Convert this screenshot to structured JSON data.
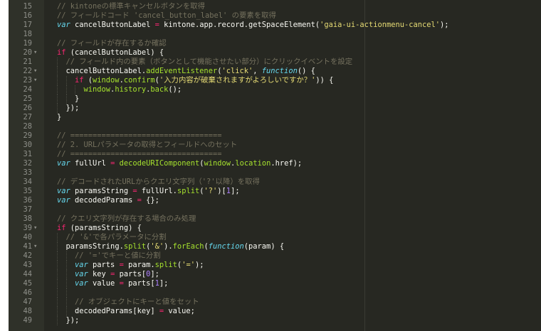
{
  "editor": {
    "lines": [
      {
        "n": "15",
        "fold": "",
        "indent": 1,
        "tokens": [
          [
            "cm",
            "// kintoneの標準キャンセルボタンを取得"
          ]
        ]
      },
      {
        "n": "16",
        "fold": "",
        "indent": 1,
        "tokens": [
          [
            "cm",
            "// フィールドコード 'cancel_button_label' の要素を取得"
          ]
        ]
      },
      {
        "n": "17",
        "fold": "",
        "indent": 1,
        "tokens": [
          [
            "kw",
            "var"
          ],
          [
            "pl",
            " cancelButtonLabel "
          ],
          [
            "op",
            "="
          ],
          [
            "pl",
            " kintone.app.record.getSpaceElement("
          ],
          [
            "str",
            "'gaia-ui-actionmenu-cancel'"
          ],
          [
            "pl",
            ");"
          ]
        ]
      },
      {
        "n": "18",
        "fold": "",
        "indent": 1,
        "tokens": []
      },
      {
        "n": "19",
        "fold": "",
        "indent": 1,
        "tokens": [
          [
            "cm",
            "// フィールドが存在するか確認"
          ]
        ]
      },
      {
        "n": "20",
        "fold": "▾",
        "indent": 1,
        "tokens": [
          [
            "ctl",
            "if"
          ],
          [
            "pl",
            " (cancelButtonLabel) {"
          ]
        ]
      },
      {
        "n": "21",
        "fold": "",
        "indent": 2,
        "tokens": [
          [
            "cm",
            "// フィールド内の要素（ボタンとして機能させたい部分）にクリックイベントを設定"
          ]
        ]
      },
      {
        "n": "22",
        "fold": "▾",
        "indent": 2,
        "tokens": [
          [
            "pl",
            "cancelButtonLabel."
          ],
          [
            "fn",
            "addEventListener"
          ],
          [
            "pl",
            "("
          ],
          [
            "str",
            "'click'"
          ],
          [
            "pl",
            ", "
          ],
          [
            "kw",
            "function"
          ],
          [
            "pl",
            "() {"
          ]
        ]
      },
      {
        "n": "23",
        "fold": "▾",
        "indent": 3,
        "tokens": [
          [
            "ctl",
            "if"
          ],
          [
            "pl",
            " ("
          ],
          [
            "fn",
            "window"
          ],
          [
            "pl",
            "."
          ],
          [
            "fn",
            "confirm"
          ],
          [
            "pl",
            "("
          ],
          [
            "str",
            "'入力内容が破棄されますがよろしいですか？'"
          ],
          [
            "pl",
            ")) {"
          ]
        ]
      },
      {
        "n": "24",
        "fold": "",
        "indent": 4,
        "tokens": [
          [
            "fn",
            "window"
          ],
          [
            "pl",
            "."
          ],
          [
            "fn",
            "history"
          ],
          [
            "pl",
            "."
          ],
          [
            "fn",
            "back"
          ],
          [
            "pl",
            "();"
          ]
        ]
      },
      {
        "n": "25",
        "fold": "",
        "indent": 3,
        "tokens": [
          [
            "pl",
            "}"
          ]
        ]
      },
      {
        "n": "26",
        "fold": "",
        "indent": 2,
        "tokens": [
          [
            "pl",
            "});"
          ]
        ]
      },
      {
        "n": "27",
        "fold": "",
        "indent": 1,
        "tokens": [
          [
            "pl",
            "}"
          ]
        ]
      },
      {
        "n": "28",
        "fold": "",
        "indent": 1,
        "tokens": []
      },
      {
        "n": "29",
        "fold": "",
        "indent": 1,
        "tokens": [
          [
            "cm",
            "// =================================="
          ]
        ]
      },
      {
        "n": "30",
        "fold": "",
        "indent": 1,
        "tokens": [
          [
            "cm",
            "// 2. URLパラメータの取得とフィールドへのセット"
          ]
        ]
      },
      {
        "n": "31",
        "fold": "",
        "indent": 1,
        "tokens": [
          [
            "cm",
            "// =================================="
          ]
        ]
      },
      {
        "n": "32",
        "fold": "",
        "indent": 1,
        "tokens": [
          [
            "kw",
            "var"
          ],
          [
            "pl",
            " fullUrl "
          ],
          [
            "op",
            "="
          ],
          [
            "pl",
            " "
          ],
          [
            "fn",
            "decodeURIComponent"
          ],
          [
            "pl",
            "("
          ],
          [
            "fn",
            "window"
          ],
          [
            "pl",
            "."
          ],
          [
            "fn",
            "location"
          ],
          [
            "pl",
            ".href);"
          ]
        ]
      },
      {
        "n": "33",
        "fold": "",
        "indent": 1,
        "tokens": []
      },
      {
        "n": "34",
        "fold": "",
        "indent": 1,
        "tokens": [
          [
            "cm",
            "// デコードされたURLからクエリ文字列（'?'以降）を取得"
          ]
        ]
      },
      {
        "n": "35",
        "fold": "",
        "indent": 1,
        "tokens": [
          [
            "kw",
            "var"
          ],
          [
            "pl",
            " paramsString "
          ],
          [
            "op",
            "="
          ],
          [
            "pl",
            " fullUrl."
          ],
          [
            "fn",
            "split"
          ],
          [
            "pl",
            "("
          ],
          [
            "str",
            "'?'"
          ],
          [
            "pl",
            ")["
          ],
          [
            "num",
            "1"
          ],
          [
            "pl",
            "];"
          ]
        ]
      },
      {
        "n": "36",
        "fold": "",
        "indent": 1,
        "tokens": [
          [
            "kw",
            "var"
          ],
          [
            "pl",
            " decodedParams "
          ],
          [
            "op",
            "="
          ],
          [
            "pl",
            " {};"
          ]
        ]
      },
      {
        "n": "37",
        "fold": "",
        "indent": 1,
        "tokens": []
      },
      {
        "n": "38",
        "fold": "",
        "indent": 1,
        "tokens": [
          [
            "cm",
            "// クエリ文字列が存在する場合のみ処理"
          ]
        ]
      },
      {
        "n": "39",
        "fold": "▾",
        "indent": 1,
        "tokens": [
          [
            "ctl",
            "if"
          ],
          [
            "pl",
            " (paramsString) {"
          ]
        ]
      },
      {
        "n": "40",
        "fold": "",
        "indent": 2,
        "tokens": [
          [
            "cm",
            "// '&'で各パラメータに分割"
          ]
        ]
      },
      {
        "n": "41",
        "fold": "▾",
        "indent": 2,
        "tokens": [
          [
            "pl",
            "paramsString."
          ],
          [
            "fn",
            "split"
          ],
          [
            "pl",
            "("
          ],
          [
            "str",
            "'&'"
          ],
          [
            "pl",
            ")."
          ],
          [
            "fn",
            "forEach"
          ],
          [
            "pl",
            "("
          ],
          [
            "kw",
            "function"
          ],
          [
            "pl",
            "(param) {"
          ]
        ]
      },
      {
        "n": "42",
        "fold": "",
        "indent": 3,
        "tokens": [
          [
            "cm",
            "// '='でキーと値に分割"
          ]
        ]
      },
      {
        "n": "43",
        "fold": "",
        "indent": 3,
        "tokens": [
          [
            "kw",
            "var"
          ],
          [
            "pl",
            " parts "
          ],
          [
            "op",
            "="
          ],
          [
            "pl",
            " param."
          ],
          [
            "fn",
            "split"
          ],
          [
            "pl",
            "("
          ],
          [
            "str",
            "'='"
          ],
          [
            "pl",
            ");"
          ]
        ]
      },
      {
        "n": "44",
        "fold": "",
        "indent": 3,
        "tokens": [
          [
            "kw",
            "var"
          ],
          [
            "pl",
            " key "
          ],
          [
            "op",
            "="
          ],
          [
            "pl",
            " parts["
          ],
          [
            "num",
            "0"
          ],
          [
            "pl",
            "];"
          ]
        ]
      },
      {
        "n": "45",
        "fold": "",
        "indent": 3,
        "tokens": [
          [
            "kw",
            "var"
          ],
          [
            "pl",
            " value "
          ],
          [
            "op",
            "="
          ],
          [
            "pl",
            " parts["
          ],
          [
            "num",
            "1"
          ],
          [
            "pl",
            "];"
          ]
        ]
      },
      {
        "n": "46",
        "fold": "",
        "indent": 3,
        "tokens": []
      },
      {
        "n": "47",
        "fold": "",
        "indent": 3,
        "tokens": [
          [
            "cm",
            "// オブジェクトにキーと値をセット"
          ]
        ]
      },
      {
        "n": "48",
        "fold": "",
        "indent": 3,
        "tokens": [
          [
            "pl",
            "decodedParams[key] "
          ],
          [
            "op",
            "="
          ],
          [
            "pl",
            " value;"
          ]
        ]
      },
      {
        "n": "49",
        "fold": "",
        "indent": 2,
        "tokens": [
          [
            "pl",
            "});"
          ]
        ]
      }
    ]
  },
  "colors": {
    "background": "#272822",
    "comment": "#75715e",
    "keyword": "#66d9ef",
    "control": "#f92672",
    "string": "#e6db74",
    "function": "#a6e22e",
    "number": "#ae81ff",
    "plain": "#f8f8f2"
  }
}
